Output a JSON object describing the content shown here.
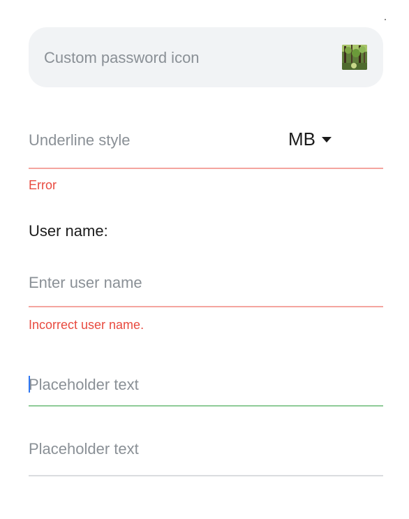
{
  "password_field": {
    "placeholder": "Custom password icon",
    "icon": "forest-image-icon"
  },
  "underline_style_field": {
    "placeholder": "Underline style",
    "unit_select": {
      "value": "MB",
      "icon": "caret-down-icon"
    },
    "error": "Error"
  },
  "username": {
    "label": "User name:",
    "placeholder": "Enter user name",
    "error": "Incorrect user name."
  },
  "focused_field": {
    "placeholder": "Placeholder text"
  },
  "normal_field": {
    "placeholder": "Placeholder text"
  },
  "colors": {
    "error": "#e84a3f",
    "error_underline": "#f4a59f",
    "focus_underline": "#8ecb97",
    "normal_underline": "#dadcdf",
    "cursor": "#2f77f2",
    "placeholder": "#8a9096",
    "field_background": "#f1f3f5"
  }
}
